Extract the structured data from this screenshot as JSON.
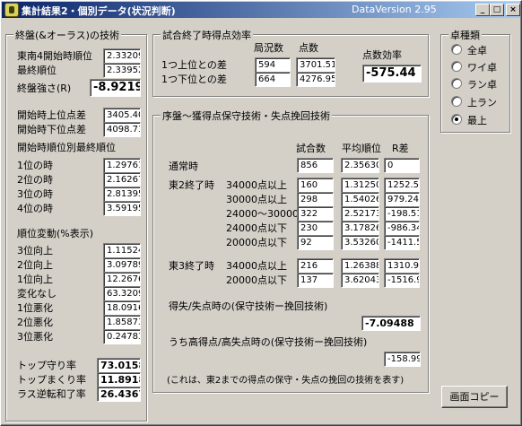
{
  "window": {
    "title": "集計結果2・個別データ(状況判断)",
    "version": "DataVersion 2.95",
    "minimize": "_",
    "maximize": "□",
    "close": "×"
  },
  "left": {
    "title": "終盤(&オーラス)の技術",
    "rows": [
      {
        "label": "東南4開始時順位",
        "value": "2.33209"
      },
      {
        "label": "最終順位",
        "value": "2.33952"
      }
    ],
    "strength": {
      "label": "終盤強さ(R)",
      "value": "-8.9219"
    },
    "diff_rows": [
      {
        "label": "開始時上位点差",
        "value": "3405.40"
      },
      {
        "label": "開始時下位点差",
        "value": "4098.73"
      }
    ],
    "final_by_start_title": "開始時順位別最終順位",
    "final_by_start": [
      {
        "label": "1位の時",
        "value": "1.29761"
      },
      {
        "label": "2位の時",
        "value": "2.16267"
      },
      {
        "label": "3位の時",
        "value": "2.81395"
      },
      {
        "label": "4位の時",
        "value": "3.59195"
      }
    ],
    "change_title": "順位変動(%表示)",
    "changes": [
      {
        "label": "3位向上",
        "value": "1.11524"
      },
      {
        "label": "2位向上",
        "value": "3.09789"
      },
      {
        "label": "1位向上",
        "value": "12.2676"
      },
      {
        "label": "変化なし",
        "value": "63.3209"
      },
      {
        "label": "1位悪化",
        "value": "18.0916"
      },
      {
        "label": "2位悪化",
        "value": "1.85873"
      },
      {
        "label": "3位悪化",
        "value": "0.24783"
      }
    ],
    "bottom": [
      {
        "label": "トップ守り率",
        "value": "73.0158"
      },
      {
        "label": "トップまくり率",
        "value": "11.8918"
      },
      {
        "label": "ラス逆転和了率",
        "value": "26.4367"
      }
    ]
  },
  "efficiency": {
    "title": "試合終了時得点効率",
    "col_count": "局況数",
    "col_score": "点数",
    "col_eff": "点数効率",
    "rows": [
      {
        "label": "1つ上位との差",
        "count": "594",
        "score": "3701.51"
      },
      {
        "label": "1つ下位との差",
        "count": "664",
        "score": "4276.95"
      }
    ],
    "eff_value": "-575.44"
  },
  "early": {
    "title": "序盤〜獲得点保守技術・失点挽回技術",
    "col_games": "試合数",
    "col_avg": "平均順位",
    "col_r": "R差",
    "normal": {
      "label": "通常時",
      "games": "856",
      "avg": "2.35630",
      "r": "0"
    },
    "east2_label": "東2終了時",
    "east2": [
      {
        "label": "34000点以上",
        "games": "160",
        "avg": "1.31250",
        "r": "1252.57"
      },
      {
        "label": "30000点以上",
        "games": "298",
        "avg": "1.54026",
        "r": "979.248"
      },
      {
        "label": "24000〜30000",
        "games": "322",
        "avg": "2.52173",
        "r": "-198.51"
      },
      {
        "label": "24000点以下",
        "games": "230",
        "avg": "3.17826",
        "r": "-986.34"
      },
      {
        "label": "20000点以下",
        "games": "92",
        "avg": "3.53260",
        "r": "-1411.5"
      }
    ],
    "east3_label": "東3終了時",
    "east3": [
      {
        "label": "34000点以上",
        "games": "216",
        "avg": "1.26388",
        "r": "1310.90"
      },
      {
        "label": "20000点以下",
        "games": "137",
        "avg": "3.62043",
        "r": "-1516.9"
      }
    ],
    "gain_loss_label": "得失/失点時の(保守技術ー挽回技術)",
    "gain_loss_value": "-7.09488",
    "high_label": "うち高得点/高失点時の(保守技術ー挽回技術)",
    "high_value": "-158.99",
    "note": "(これは、東2までの得点の保守・失点の挽回の技術を表す)"
  },
  "table_type": {
    "title": "卓種類",
    "options": [
      {
        "label": "全卓",
        "checked": false
      },
      {
        "label": "ワイ卓",
        "checked": false
      },
      {
        "label": "ラン卓",
        "checked": false
      },
      {
        "label": "上ラン",
        "checked": false
      },
      {
        "label": "最上",
        "checked": true
      }
    ]
  },
  "copy_button": "画面コピー"
}
